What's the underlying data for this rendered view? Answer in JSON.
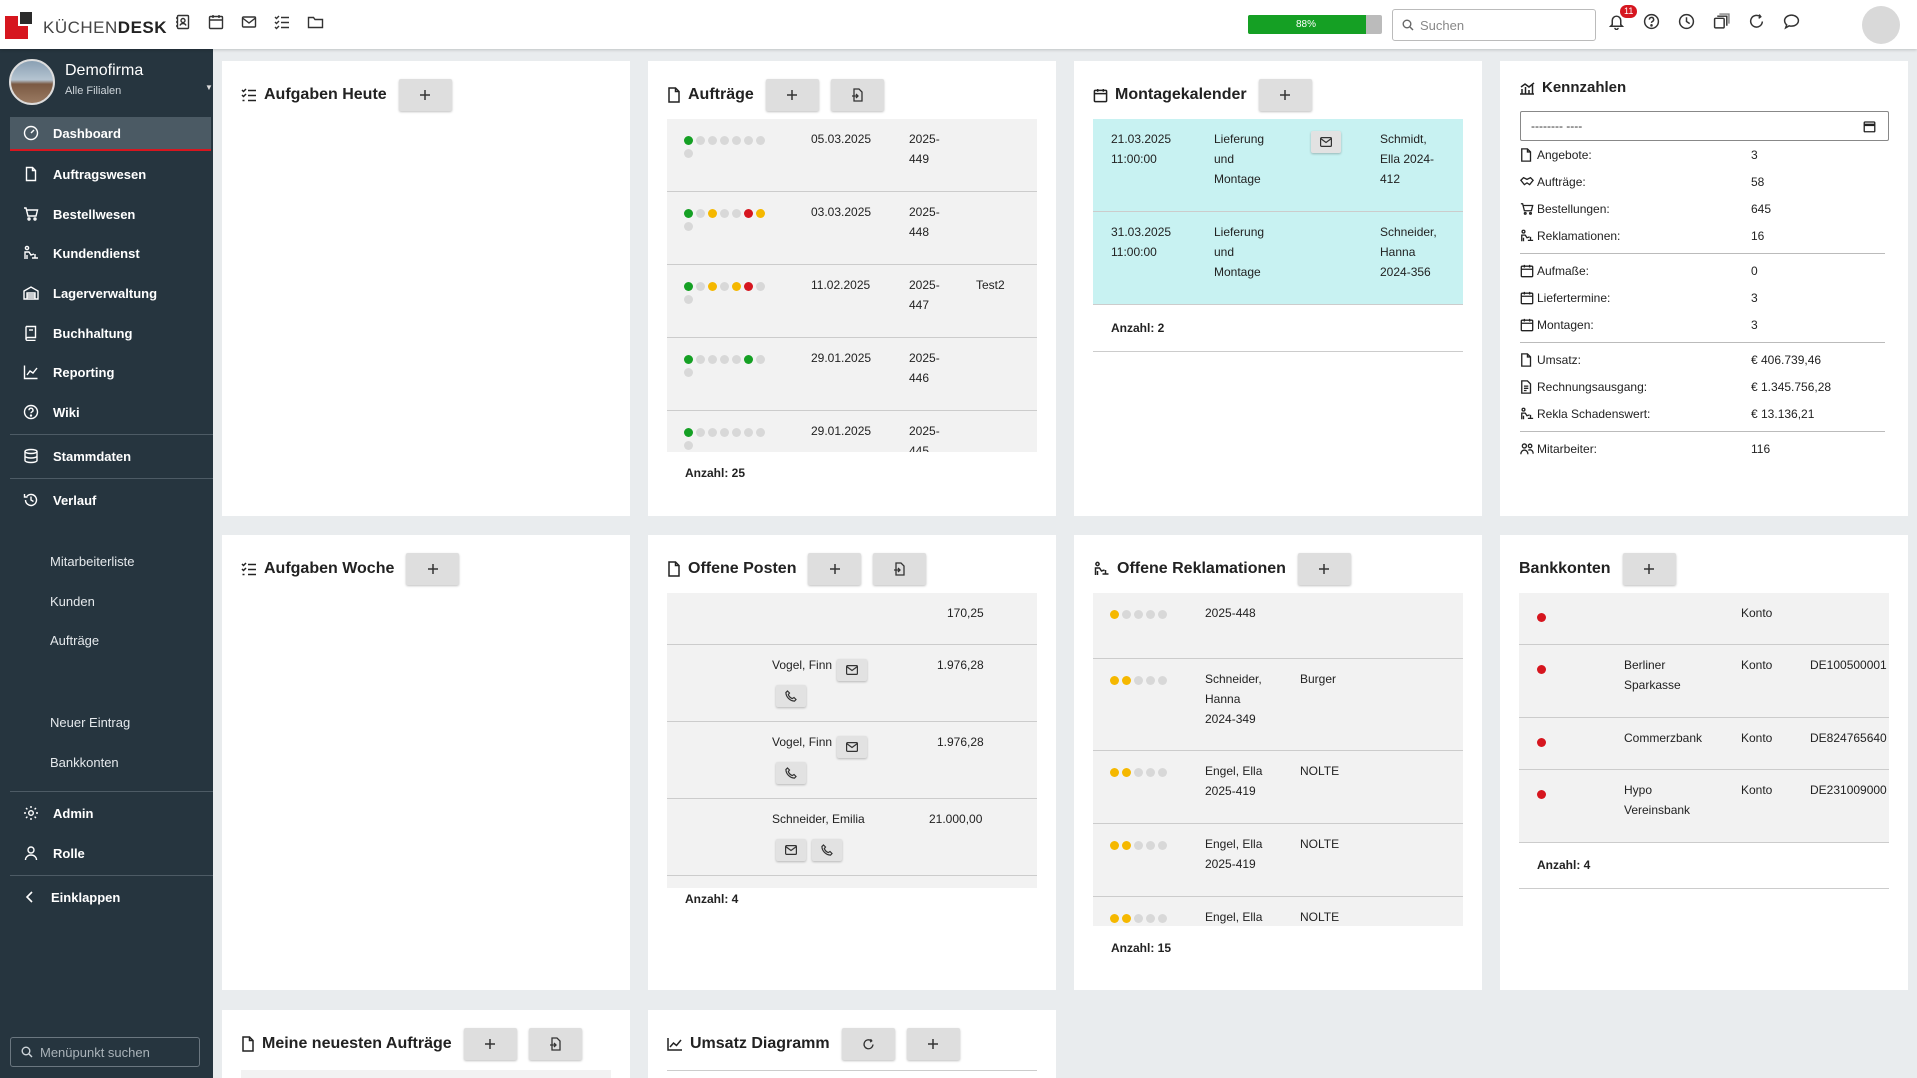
{
  "topbar": {
    "logo_light": "KÜCHEN",
    "logo_bold": "DESK",
    "progress_value": 0.88,
    "progress_label": "88%",
    "search_placeholder": "Suchen",
    "notification_count": "11"
  },
  "sidebar": {
    "company_name": "Demofirma",
    "company_sub": "Alle Filialen",
    "items": [
      {
        "label": "Dashboard",
        "icon": "dashboard-icon"
      },
      {
        "label": "Auftragswesen",
        "icon": "document-icon"
      },
      {
        "label": "Bestellwesen",
        "icon": "cart-icon"
      },
      {
        "label": "Kundendienst",
        "icon": "service-icon"
      },
      {
        "label": "Lagerverwaltung",
        "icon": "warehouse-icon"
      },
      {
        "label": "Buchhaltung",
        "icon": "book-icon"
      },
      {
        "label": "Reporting",
        "icon": "chart-icon"
      },
      {
        "label": "Wiki",
        "icon": "help-icon"
      },
      {
        "label": "Stammdaten",
        "icon": "database-icon"
      },
      {
        "label": "Verlauf",
        "icon": "history-icon"
      }
    ],
    "history": [
      "Mitarbeiterliste",
      "Kunden",
      "Aufträge"
    ],
    "shortcuts": [
      "Neuer Eintrag",
      "Bankkonten"
    ],
    "admin": "Admin",
    "role": "Rolle",
    "collapse": "Einklappen",
    "menu_search_placeholder": "Menüpunkt suchen"
  },
  "cards": {
    "tasks_today": {
      "title": "Aufgaben Heute"
    },
    "orders": {
      "title": "Aufträge",
      "rows": [
        {
          "date": "05.03.2025",
          "num1": "2025-",
          "num2": "449",
          "extra": "",
          "dots": [
            "green",
            "grey",
            "grey",
            "grey",
            "grey",
            "grey",
            "grey",
            "grey"
          ]
        },
        {
          "date": "03.03.2025",
          "num1": "2025-",
          "num2": "448",
          "extra": "",
          "dots": [
            "green",
            "grey",
            "yellow",
            "grey",
            "grey",
            "red",
            "yellow",
            "grey"
          ]
        },
        {
          "date": "11.02.2025",
          "num1": "2025-",
          "num2": "447",
          "extra": "Test2",
          "dots": [
            "green",
            "grey",
            "yellow",
            "grey",
            "yellow",
            "red",
            "grey",
            "grey"
          ]
        },
        {
          "date": "29.01.2025",
          "num1": "2025-",
          "num2": "446",
          "extra": "",
          "dots": [
            "green",
            "grey",
            "grey",
            "grey",
            "grey",
            "green",
            "grey",
            "grey"
          ]
        },
        {
          "date": "29.01.2025",
          "num1": "2025-",
          "num2": "445",
          "extra": "",
          "dots": [
            "green",
            "grey",
            "grey",
            "grey",
            "grey",
            "grey",
            "grey",
            "grey"
          ]
        }
      ],
      "count": "Anzahl: 25"
    },
    "calendar": {
      "title": "Montagekalender",
      "rows": [
        {
          "date": "21.03.2025",
          "time": "11:00:00",
          "type": [
            "Lieferung",
            "und",
            "Montage"
          ],
          "customer": [
            "Schmidt,",
            "Ella 2024-",
            "412"
          ],
          "mail": true
        },
        {
          "date": "31.03.2025",
          "time": "11:00:00",
          "type": [
            "Lieferung",
            "und",
            "Montage"
          ],
          "customer": [
            "Schneider,",
            "Hanna",
            "2024-356"
          ],
          "mail": false
        }
      ],
      "count": "Anzahl: 2"
    },
    "kpis": {
      "title": "Kennzahlen",
      "date_placeholder": "-------- ----",
      "groups": [
        [
          {
            "icon": "document-icon",
            "label": "Angebote:",
            "value": "3"
          },
          {
            "icon": "handshake-icon",
            "label": "Aufträge:",
            "value": "58"
          },
          {
            "icon": "cart-icon",
            "label": "Bestellungen:",
            "value": "645"
          },
          {
            "icon": "service-icon",
            "label": "Reklamationen:",
            "value": "16"
          }
        ],
        [
          {
            "icon": "calendar-icon",
            "label": "Aufmaße:",
            "value": "0"
          },
          {
            "icon": "calendar-icon",
            "label": "Liefertermine:",
            "value": "3"
          },
          {
            "icon": "calendar-icon",
            "label": "Montagen:",
            "value": "3"
          }
        ],
        [
          {
            "icon": "document-icon",
            "label": "Umsatz:",
            "value": "€ 406.739,46"
          },
          {
            "icon": "invoice-icon",
            "label": "Rechnungsausgang:",
            "value": "€ 1.345.756,28"
          },
          {
            "icon": "service-icon",
            "label": "Rekla Schadenswert:",
            "value": "€ 13.136,21"
          }
        ],
        [
          {
            "icon": "people-icon",
            "label": "Mitarbeiter:",
            "value": "116"
          }
        ]
      ]
    },
    "tasks_week": {
      "title": "Aufgaben Woche"
    },
    "open_items": {
      "title": "Offene Posten",
      "rows": [
        {
          "name": "",
          "amount": "170,25",
          "mail": false,
          "phone": false
        },
        {
          "name": "Vogel, Finn",
          "amount": "1.976,28",
          "mail": true,
          "phone": true
        },
        {
          "name": "Vogel, Finn",
          "amount": "1.976,28",
          "mail": true,
          "phone": true
        },
        {
          "name": "Schneider, Emilia",
          "amount": "21.000,00",
          "mail": true,
          "phone": true
        }
      ],
      "count": "Anzahl: 4"
    },
    "complaints": {
      "title": "Offene Reklamationen",
      "rows": [
        {
          "ref": [
            "2025-448"
          ],
          "brand": "",
          "dots": [
            "yellow",
            "grey",
            "grey",
            "grey",
            "grey"
          ]
        },
        {
          "ref": [
            "Schneider,",
            "Hanna",
            "2024-349"
          ],
          "brand": "Burger",
          "dots": [
            "yellow",
            "yellow",
            "grey",
            "grey",
            "grey"
          ]
        },
        {
          "ref": [
            "Engel, Ella",
            "2025-419"
          ],
          "brand": "NOLTE",
          "dots": [
            "yellow",
            "yellow",
            "grey",
            "grey",
            "grey"
          ]
        },
        {
          "ref": [
            "Engel, Ella",
            "2025-419"
          ],
          "brand": "NOLTE",
          "dots": [
            "yellow",
            "yellow",
            "grey",
            "grey",
            "grey"
          ]
        },
        {
          "ref": [
            "Engel, Ella"
          ],
          "brand": "NOLTE",
          "dots": [
            "yellow",
            "yellow",
            "grey",
            "grey",
            "grey"
          ]
        }
      ],
      "count": "Anzahl: 15"
    },
    "bank": {
      "title": "Bankkonten",
      "rows": [
        {
          "bank": [],
          "type": "Konto",
          "iban": ""
        },
        {
          "bank": [
            "Berliner",
            "Sparkasse"
          ],
          "type": "Konto",
          "iban": "DE100500001"
        },
        {
          "bank": [
            "Commerzbank"
          ],
          "type": "Konto",
          "iban": "DE824765640"
        },
        {
          "bank": [
            "Hypo",
            "Vereinsbank"
          ],
          "type": "Konto",
          "iban": "DE231009000"
        }
      ],
      "count": "Anzahl: 4"
    },
    "my_orders": {
      "title": "Meine neuesten Aufträge"
    },
    "revenue_chart": {
      "title": "Umsatz Diagramm"
    }
  },
  "colors": {
    "green": "#15a024",
    "yellow": "#f5b800",
    "red": "#d6161f",
    "grey": "#d8d8d8",
    "calendar_row": "#c8f2f2",
    "sidebar": "#26353f"
  }
}
